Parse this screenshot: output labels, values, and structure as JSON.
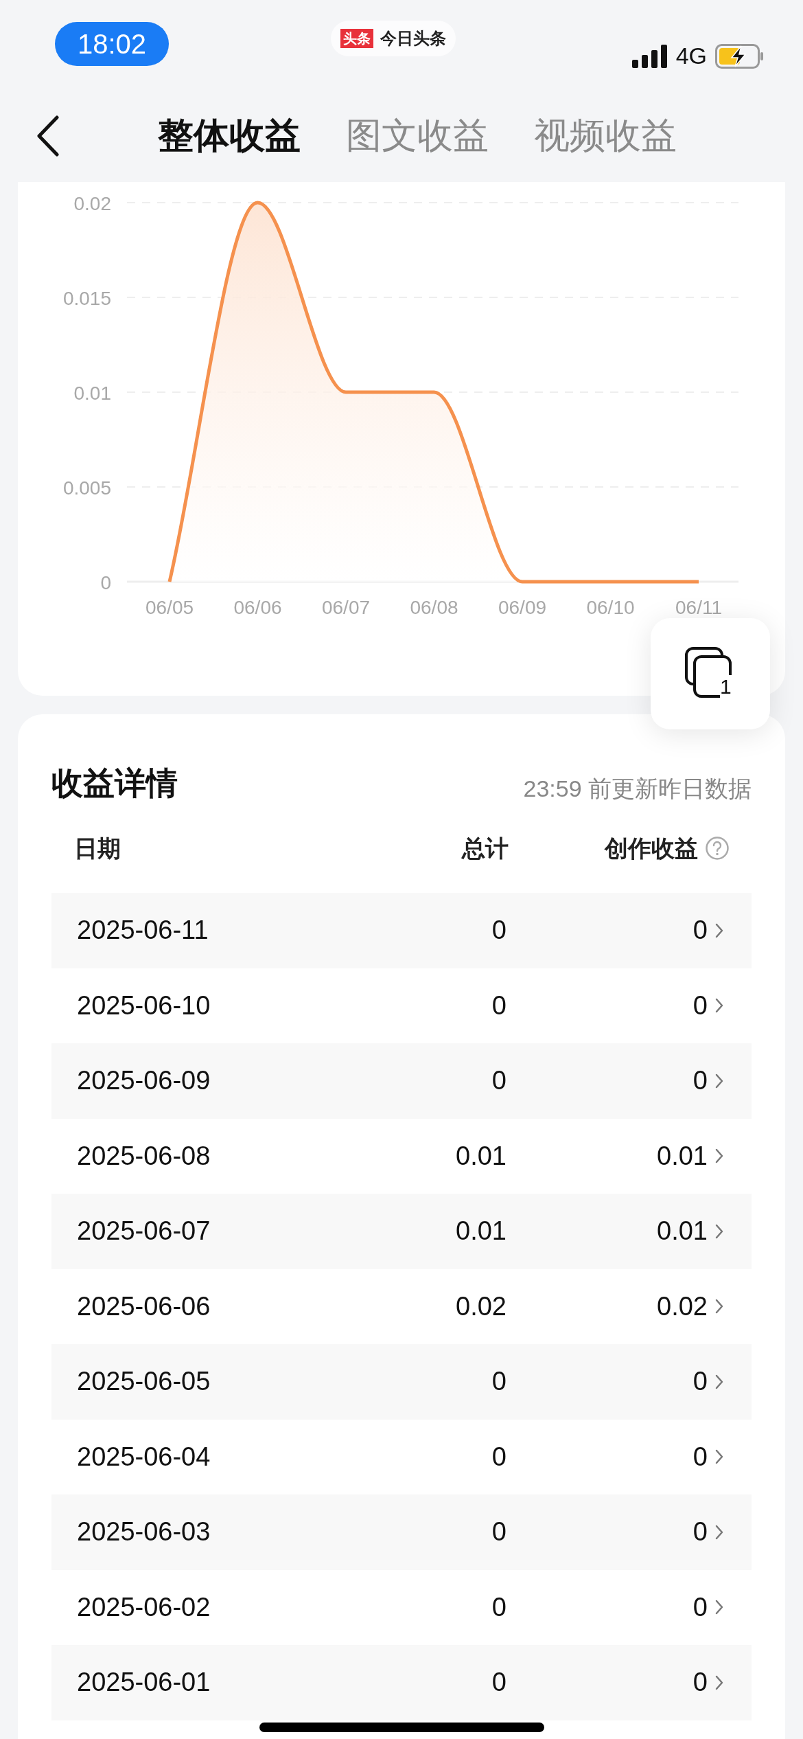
{
  "status_bar": {
    "time": "18:02",
    "app_badge": "头条",
    "app_name": "今日头条",
    "network": "4G"
  },
  "nav": {
    "tabs": [
      {
        "label": "整体收益",
        "selected": true
      },
      {
        "label": "图文收益",
        "selected": false
      },
      {
        "label": "视频收益",
        "selected": false
      }
    ]
  },
  "chart": {
    "chart_data": {
      "type": "line",
      "categories": [
        "06/05",
        "06/06",
        "06/07",
        "06/08",
        "06/09",
        "06/10",
        "06/11"
      ],
      "grid": true,
      "series": [
        {
          "color": "#f5914e",
          "values": [
            0,
            0.02,
            0.01,
            0.01,
            0,
            0,
            0
          ]
        }
      ],
      "ylim": [
        0,
        0.02
      ],
      "yticks": [
        {
          "value": 0,
          "label": "0"
        },
        {
          "value": 0.005,
          "label": "0.005"
        },
        {
          "value": 0.01,
          "label": "0.01"
        },
        {
          "value": 0.015,
          "label": "0.015"
        },
        {
          "value": 0.02,
          "label": "0.02"
        }
      ]
    }
  },
  "floating_button": {
    "count": "1"
  },
  "details": {
    "title": "收益详情",
    "note": "23:59 前更新昨日数据",
    "columns": [
      "日期",
      "总计",
      "创作收益"
    ],
    "rows": [
      {
        "date": "2025-06-11",
        "total": "0",
        "creation": "0"
      },
      {
        "date": "2025-06-10",
        "total": "0",
        "creation": "0"
      },
      {
        "date": "2025-06-09",
        "total": "0",
        "creation": "0"
      },
      {
        "date": "2025-06-08",
        "total": "0.01",
        "creation": "0.01"
      },
      {
        "date": "2025-06-07",
        "total": "0.01",
        "creation": "0.01"
      },
      {
        "date": "2025-06-06",
        "total": "0.02",
        "creation": "0.02"
      },
      {
        "date": "2025-06-05",
        "total": "0",
        "creation": "0"
      },
      {
        "date": "2025-06-04",
        "total": "0",
        "creation": "0"
      },
      {
        "date": "2025-06-03",
        "total": "0",
        "creation": "0"
      },
      {
        "date": "2025-06-02",
        "total": "0",
        "creation": "0"
      },
      {
        "date": "2025-06-01",
        "total": "0",
        "creation": "0"
      }
    ]
  }
}
